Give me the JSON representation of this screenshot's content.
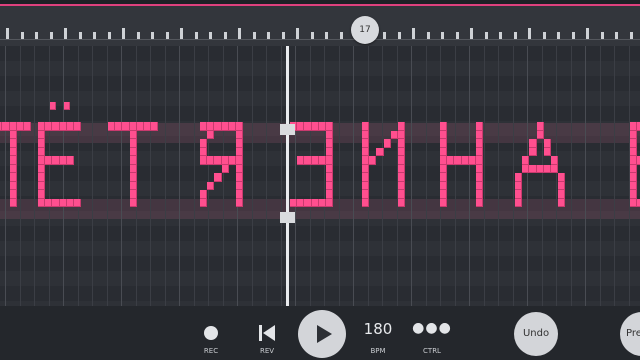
{
  "colors": {
    "accent": "#e0417e",
    "note": "#ff4f8f",
    "background": "#2a2d33"
  },
  "ruler": {
    "bar_marker": "17"
  },
  "transport": {
    "rec_label": "REC",
    "rev_label": "REV",
    "bpm_value": "180",
    "bpm_label": "BPM",
    "ctrl_label": "CTRL",
    "undo_label": "Undo",
    "pre_label": "Pre"
  },
  "icons": [
    "record-icon",
    "rewind-icon",
    "play-icon",
    "more-icon"
  ]
}
